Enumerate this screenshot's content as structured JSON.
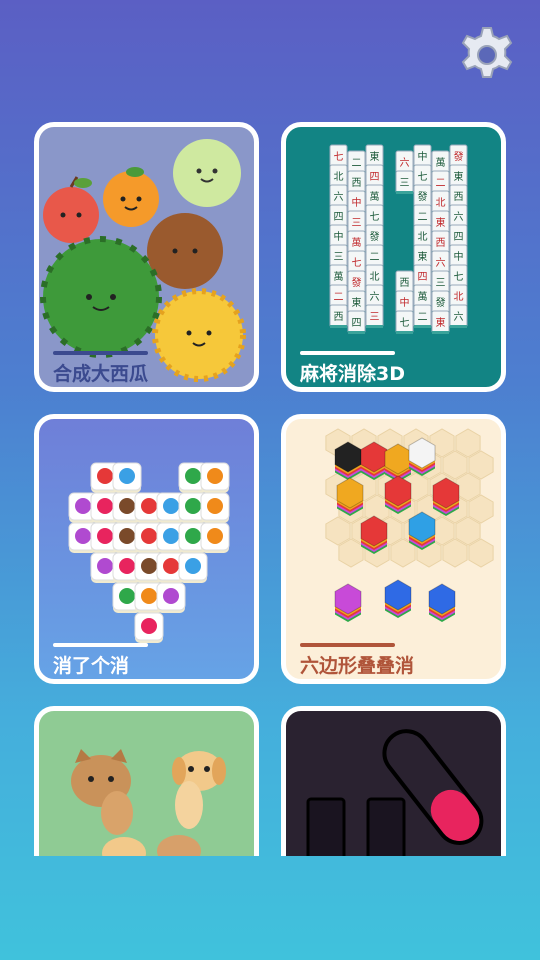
{
  "settings": {
    "icon": "gear-icon"
  },
  "games": [
    {
      "title": "合成大西瓜"
    },
    {
      "title": "麻将消除3D"
    },
    {
      "title": "消了个消"
    },
    {
      "title": "六边形叠叠消"
    },
    {
      "title": ""
    },
    {
      "title": ""
    }
  ],
  "mahjong_glyphs": [
    "七",
    "二",
    "東",
    "六",
    "中",
    "萬",
    "發",
    "北",
    "西",
    "四",
    "三"
  ],
  "colors": {
    "bg_top": "#5b5fc4",
    "bg_bottom": "#40c2dc",
    "label_watermelon": "#3b4a8f",
    "label_hex": "#b0553a",
    "accent_red": "#e8245e"
  }
}
